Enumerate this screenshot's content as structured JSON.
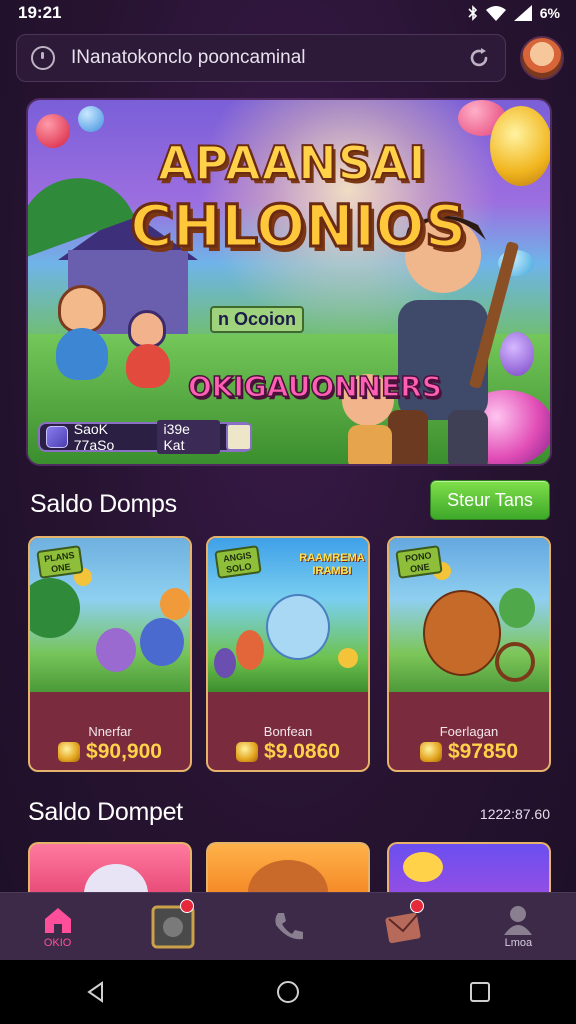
{
  "status_bar": {
    "time": "19:21",
    "battery": "6%"
  },
  "search": {
    "text": "INanatokonclo pooncaminal"
  },
  "hero": {
    "title_line1": "APAANSAI",
    "title_line2": "CHLONIOS",
    "sign_text": "n Ocoion",
    "subtitle": "OKIGAUONNERS",
    "chip_text": "SaoK 77aSo",
    "chip_tag": "i39e Kat"
  },
  "section1": {
    "title": "Saldo Domps",
    "button_label": "Steur Tans"
  },
  "cards": [
    {
      "tag": "PLANS ONE",
      "name": "Nnerfar",
      "price": "$90,900"
    },
    {
      "tag": "ANGIS SOLO",
      "name": "Bonfean",
      "price": "$9.0860",
      "banner": "RAAMREMA IRAMBI"
    },
    {
      "tag": "PONO ONE",
      "name": "Foerlagan",
      "price": "$97850"
    }
  ],
  "section2": {
    "title": "Saldo Dompet",
    "counter": "1222:87.60"
  },
  "bottom_nav": {
    "items": [
      {
        "label": "OKIO",
        "icon": "home-icon",
        "active": true
      },
      {
        "label": "",
        "icon": "game-icon",
        "active": false
      },
      {
        "label": "",
        "icon": "phone-icon",
        "active": false
      },
      {
        "label": "",
        "icon": "mail-icon",
        "active": false
      },
      {
        "label": "Lmoa",
        "icon": "profile-icon",
        "active": false
      }
    ]
  },
  "colors": {
    "accent_pink": "#ff4f9a",
    "button_green": "#4fc234",
    "background": "#241230",
    "card_gold": "#ffd24a"
  }
}
